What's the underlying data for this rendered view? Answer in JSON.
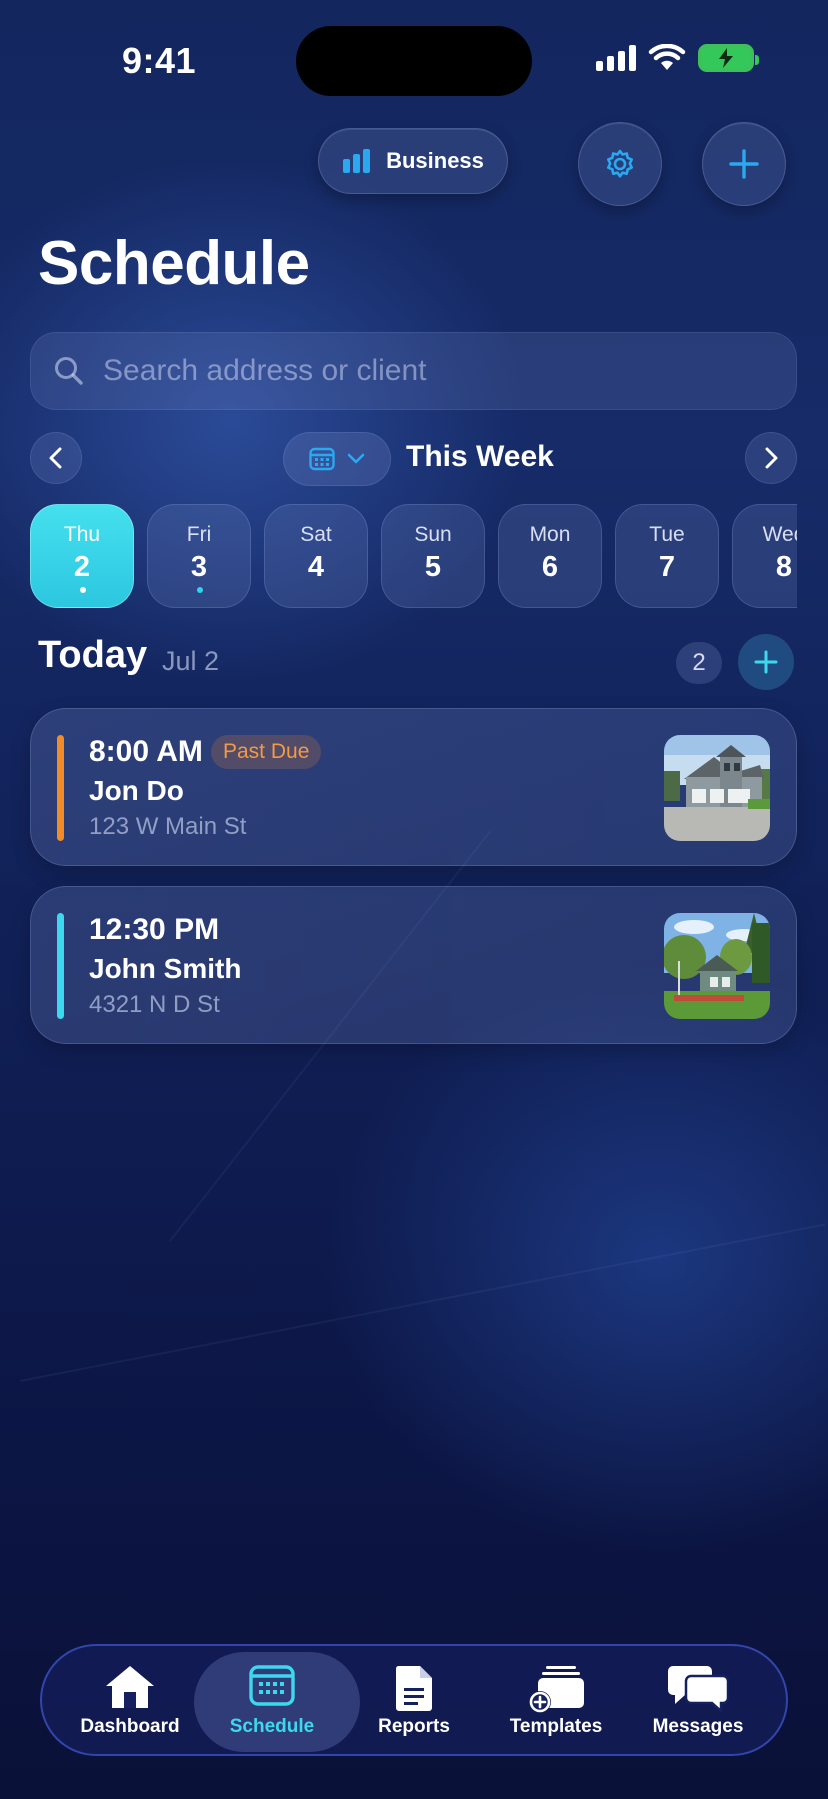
{
  "status_bar": {
    "time": "9:41"
  },
  "header": {
    "business_label": "Business",
    "title": "Schedule"
  },
  "search": {
    "placeholder": "Search address or client"
  },
  "week_nav": {
    "label": "This Week"
  },
  "days": [
    {
      "name": "Thu",
      "num": "2",
      "selected": true,
      "has_event": true
    },
    {
      "name": "Fri",
      "num": "3",
      "selected": false,
      "has_event": true
    },
    {
      "name": "Sat",
      "num": "4",
      "selected": false,
      "has_event": false
    },
    {
      "name": "Sun",
      "num": "5",
      "selected": false,
      "has_event": false
    },
    {
      "name": "Mon",
      "num": "6",
      "selected": false,
      "has_event": false
    },
    {
      "name": "Tue",
      "num": "7",
      "selected": false,
      "has_event": false
    },
    {
      "name": "Wed",
      "num": "8",
      "selected": false,
      "has_event": false
    }
  ],
  "today": {
    "title": "Today",
    "date": "Jul 2",
    "count": "2"
  },
  "appointments": [
    {
      "time": "8:00 AM",
      "status": "Past Due",
      "client": "Jon Do",
      "address": "123 W Main St",
      "accent": "#f28c28"
    },
    {
      "time": "12:30 PM",
      "status": "",
      "client": "John Smith",
      "address": "4321 N D St",
      "accent": "#3ed8ee"
    }
  ],
  "tabs": [
    {
      "label": "Dashboard",
      "icon": "house-icon",
      "active": false
    },
    {
      "label": "Schedule",
      "icon": "calendar-icon",
      "active": true
    },
    {
      "label": "Reports",
      "icon": "document-icon",
      "active": false
    },
    {
      "label": "Templates",
      "icon": "templates-add-icon",
      "active": false
    },
    {
      "label": "Messages",
      "icon": "chat-bubbles-icon",
      "active": false
    }
  ],
  "colors": {
    "accent": "#3ed8ee",
    "past_due": "#f29a45",
    "battery": "#34c759"
  }
}
